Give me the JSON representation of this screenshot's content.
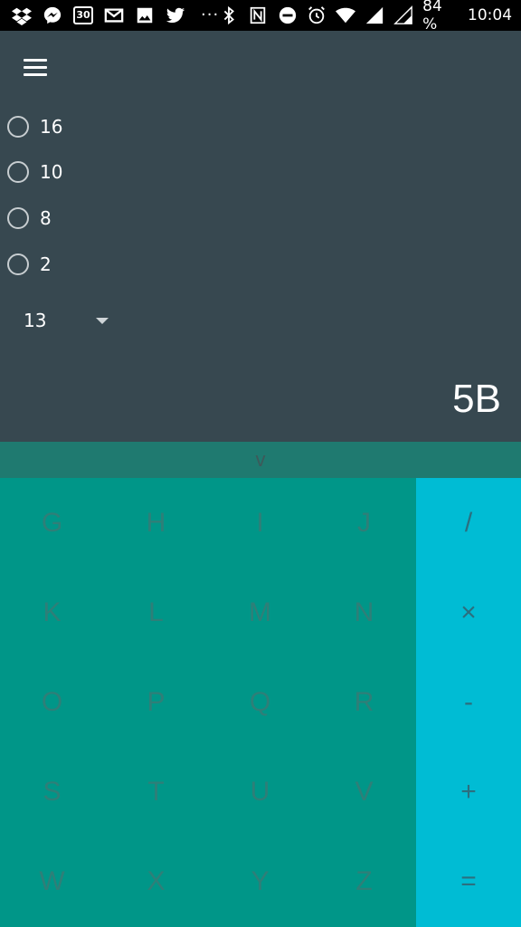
{
  "status_bar": {
    "icons": [
      "dropbox-icon",
      "messenger-icon",
      "calendar-icon",
      "gmail-icon",
      "gallery-icon",
      "twitter-icon",
      "more-notifications-icon",
      "bluetooth-icon",
      "nfc-icon",
      "do-not-disturb-icon",
      "alarm-icon",
      "wifi-icon",
      "signal-icon",
      "signal-empty-icon"
    ],
    "calendar_day": "30",
    "more": "···",
    "battery": "84 %",
    "time": "10:04"
  },
  "display": {
    "bases": [
      {
        "label": "16"
      },
      {
        "label": "10"
      },
      {
        "label": "8"
      },
      {
        "label": "2"
      }
    ],
    "select_value": "13",
    "result": "5B"
  },
  "collapse": {
    "label": "v"
  },
  "keypad": {
    "keys": [
      "G",
      "H",
      "I",
      "J",
      "K",
      "L",
      "M",
      "N",
      "O",
      "P",
      "Q",
      "R",
      "S",
      "T",
      "U",
      "V",
      "W",
      "X",
      "Y",
      "Z"
    ],
    "ops": [
      "/",
      "×",
      "-",
      "+",
      "="
    ]
  },
  "colors": {
    "display_bg": "#374850",
    "collapse_bg": "#1f7a70",
    "keypad_bg": "#009688",
    "ops_bg": "#00bcd4"
  }
}
